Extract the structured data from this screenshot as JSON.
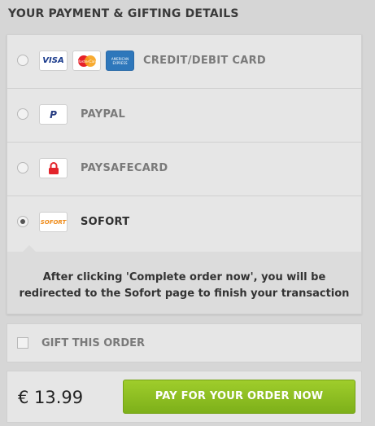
{
  "title": "YOUR PAYMENT & GIFTING DETAILS",
  "payment_options": [
    {
      "label": "CREDIT/DEBIT CARD",
      "selected": false,
      "logos": [
        "VISA",
        "MasterCard",
        "AMERICAN EXPRESS"
      ]
    },
    {
      "label": "PAYPAL",
      "selected": false,
      "logos": [
        "paypal-icon"
      ]
    },
    {
      "label": "PAYSAFECARD",
      "selected": false,
      "logos": [
        "paysafecard-lock-icon"
      ]
    },
    {
      "label": "SOFORT",
      "selected": true,
      "logos": [
        "SOFORT"
      ]
    }
  ],
  "sofort_info_line1": "After clicking 'Complete order now', you will be",
  "sofort_info_line2": "redirected to the Sofort page to finish your transaction",
  "gift": {
    "label": "GIFT THIS ORDER",
    "checked": false
  },
  "total": {
    "price": "€ 13.99",
    "button_label": "PAY FOR YOUR ORDER NOW"
  },
  "colors": {
    "accent_green": "#8bbd22",
    "background": "#d6d6d6",
    "panel": "#e6e6e6"
  }
}
